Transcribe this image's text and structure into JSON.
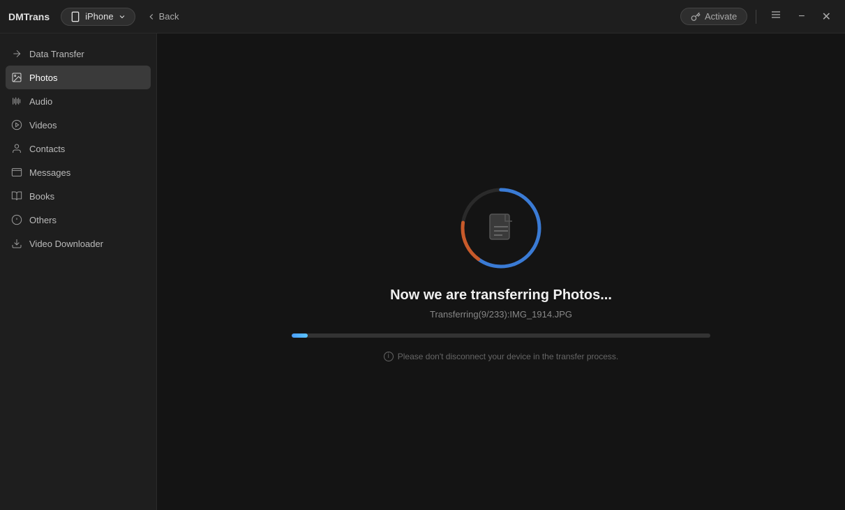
{
  "app": {
    "title": "DMTrans"
  },
  "titlebar": {
    "device": "iPhone",
    "back_label": "Back",
    "activate_label": "Activate",
    "minimize_label": "−",
    "maximize_label": "□",
    "close_label": "✕"
  },
  "sidebar": {
    "section_label": "Data Transfer",
    "items": [
      {
        "id": "data-transfer",
        "label": "Data Transfer",
        "icon": "transfer"
      },
      {
        "id": "photos",
        "label": "Photos",
        "icon": "photos",
        "active": true
      },
      {
        "id": "audio",
        "label": "Audio",
        "icon": "audio"
      },
      {
        "id": "videos",
        "label": "Videos",
        "icon": "videos"
      },
      {
        "id": "contacts",
        "label": "Contacts",
        "icon": "contacts"
      },
      {
        "id": "messages",
        "label": "Messages",
        "icon": "messages"
      },
      {
        "id": "books",
        "label": "Books",
        "icon": "books"
      },
      {
        "id": "others",
        "label": "Others",
        "icon": "others"
      },
      {
        "id": "video-downloader",
        "label": "Video Downloader",
        "icon": "download"
      }
    ]
  },
  "transfer": {
    "title": "Now we are transferring Photos...",
    "subtitle": "Transferring(9/233):IMG_1914.JPG",
    "warning": "Please don't disconnect your device in the transfer process.",
    "progress_current": 9,
    "progress_total": 233,
    "progress_percent": 3.88
  }
}
